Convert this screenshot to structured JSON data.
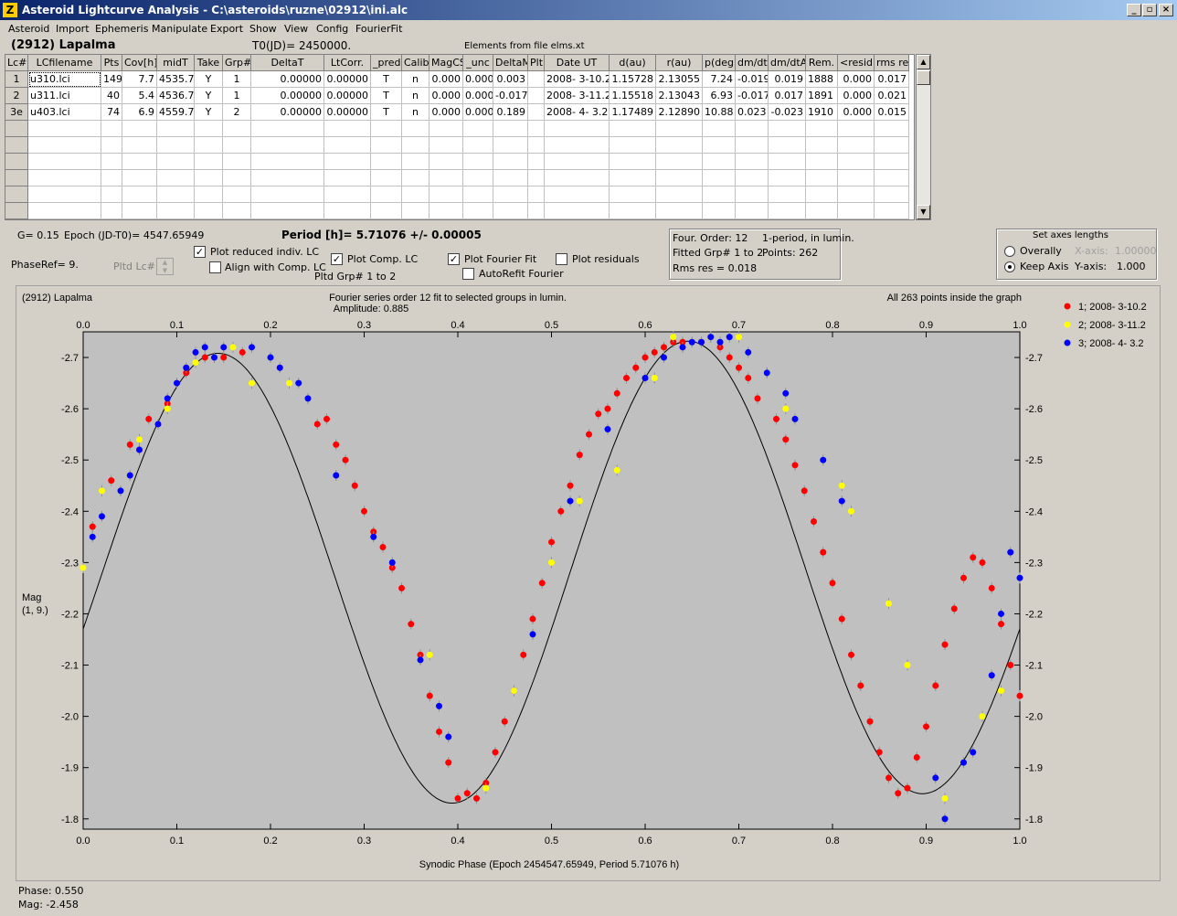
{
  "window": {
    "title": "Asteroid Lightcurve Analysis - C:\\asteroids\\ruzne\\02912\\ini.alc",
    "min": "_",
    "max": "▫",
    "close": "×"
  },
  "menu": [
    "Asteroid",
    "Import",
    "Ephemeris",
    "Manipulate",
    "Export",
    "Show",
    "View",
    "Config",
    "FourierFit"
  ],
  "header": {
    "asteroid": "(2912) Lapalma",
    "t0": "T0(JD)= 2450000.",
    "elements": "Elements from file elms.xt"
  },
  "table": {
    "columns": [
      "Lc#",
      "LCfilename",
      "Pts",
      "Cov[h]",
      "midT",
      "Take",
      "Grp#",
      "DeltaT",
      "LtCorr.",
      "_pred.",
      "Calib.",
      "MagCS",
      "_unc",
      "DeltaM",
      "Plt",
      "Date UT",
      "d(au)",
      "r(au)",
      "p(deg)",
      "dm/dt",
      "dm/dtA",
      "Rem.",
      "<resid>",
      "rms res"
    ],
    "rows": [
      [
        "1",
        "u310.lci",
        "149",
        "7.7",
        "4535.7",
        "Y",
        "1",
        "0.00000",
        "0.00000",
        "T",
        "n",
        "0.000",
        "0.000",
        "0.003",
        "",
        "2008- 3-10.2",
        "1.15728",
        "2.13055",
        "7.24",
        "-0.019",
        "0.019",
        "1888",
        "0.000",
        "0.017"
      ],
      [
        "2",
        "u311.lci",
        "40",
        "5.4",
        "4536.7",
        "Y",
        "1",
        "0.00000",
        "0.00000",
        "T",
        "n",
        "0.000",
        "0.000",
        "-0.017",
        "",
        "2008- 3-11.2",
        "1.15518",
        "2.13043",
        "6.93",
        "-0.017",
        "0.017",
        "1891",
        "0.000",
        "0.021"
      ],
      [
        "3e",
        "u403.lci",
        "74",
        "6.9",
        "4559.7",
        "Y",
        "2",
        "0.00000",
        "0.00000",
        "T",
        "n",
        "0.000",
        "0.000",
        "0.189",
        "",
        "2008- 4- 3.2",
        "1.17489",
        "2.12890",
        "10.88",
        "0.023",
        "-0.023",
        "1910",
        "0.000",
        "0.015"
      ]
    ]
  },
  "controls": {
    "g": "G= 0.15",
    "epoch": "Epoch (JD-T0)= 4547.65949",
    "period": "Period [h]= 5.71076 +/- 0.00005",
    "phaseref": "PhaseRef= 9.",
    "pltd_lc": "Pltd Lc#:",
    "plot_reduced": "Plot reduced indiv. LC",
    "align_comp": "Align with Comp. LC",
    "plot_comp": "Plot Comp. LC",
    "pltd_grp": "Pltd Grp#  1   to   2",
    "plot_fourier": "Plot Fourier Fit",
    "autorefit": "AutoRefit Fourier",
    "plot_resid": "Plot residuals",
    "four_order": "Four. Order: 12",
    "one_period": "1-period, in lumin.",
    "fitted_grp": "Fitted Grp# 1 to 2",
    "points": "Points: 262",
    "rms": "Rms res      = 0.018",
    "axes_title": "Set axes lengths",
    "overally": "Overally",
    "keep_axis": "Keep Axis",
    "xaxis_label": "X-axis:",
    "xaxis_val": "1.00000",
    "yaxis_label": "Y-axis:",
    "yaxis_val": "1.000"
  },
  "status": {
    "phase": "Phase:  0.550",
    "mag": "Mag:    -2.458"
  },
  "chart_data": {
    "type": "scatter",
    "title": "Fourier series order 12 fit to selected groups in lumin.",
    "subtitle": "Amplitude: 0.885",
    "top_left": "(2912) Lapalma",
    "top_right": "All 263 points inside the graph",
    "xlabel": "Synodic Phase (Epoch 2454547.65949, Period 5.71076 h)",
    "ylabel": "Mag",
    "ylabel2": "(1, 9.)",
    "xlim": [
      0,
      1
    ],
    "ylim": [
      -2.75,
      -1.78
    ],
    "y_inverted": true,
    "xticks": [
      0.0,
      0.1,
      0.2,
      0.3,
      0.4,
      0.5,
      0.6,
      0.7,
      0.8,
      0.9,
      1.0
    ],
    "yticks": [
      -2.7,
      -2.6,
      -2.5,
      -2.4,
      -2.3,
      -2.2,
      -2.1,
      -2.0,
      -1.9,
      -1.8
    ],
    "legend_position": "right",
    "series": [
      {
        "name": "1; 2008- 3-10.2",
        "color": "#ff0000",
        "x": [
          0.01,
          0.03,
          0.05,
          0.07,
          0.09,
          0.11,
          0.13,
          0.15,
          0.17,
          0.25,
          0.26,
          0.27,
          0.28,
          0.29,
          0.3,
          0.31,
          0.32,
          0.33,
          0.34,
          0.35,
          0.36,
          0.37,
          0.38,
          0.39,
          0.4,
          0.41,
          0.42,
          0.43,
          0.44,
          0.45,
          0.46,
          0.47,
          0.48,
          0.49,
          0.5,
          0.51,
          0.52,
          0.53,
          0.54,
          0.55,
          0.56,
          0.57,
          0.58,
          0.59,
          0.6,
          0.61,
          0.62,
          0.63,
          0.64,
          0.66,
          0.68,
          0.69,
          0.7,
          0.71,
          0.72,
          0.74,
          0.75,
          0.76,
          0.77,
          0.78,
          0.79,
          0.8,
          0.81,
          0.82,
          0.83,
          0.84,
          0.85,
          0.86,
          0.87,
          0.88,
          0.89,
          0.9,
          0.91,
          0.92,
          0.93,
          0.94,
          0.95,
          0.96,
          0.97,
          0.98,
          0.99,
          1.0
        ],
        "y": [
          -2.37,
          -2.46,
          -2.53,
          -2.58,
          -2.61,
          -2.67,
          -2.7,
          -2.7,
          -2.71,
          -2.57,
          -2.58,
          -2.53,
          -2.5,
          -2.45,
          -2.4,
          -2.36,
          -2.33,
          -2.29,
          -2.25,
          -2.18,
          -2.12,
          -2.04,
          -1.97,
          -1.91,
          -1.84,
          -1.85,
          -1.84,
          -1.87,
          -1.93,
          -1.99,
          -2.05,
          -2.12,
          -2.19,
          -2.26,
          -2.34,
          -2.4,
          -2.45,
          -2.51,
          -2.55,
          -2.59,
          -2.6,
          -2.63,
          -2.66,
          -2.68,
          -2.7,
          -2.71,
          -2.72,
          -2.73,
          -2.73,
          -2.73,
          -2.72,
          -2.7,
          -2.68,
          -2.66,
          -2.62,
          -2.58,
          -2.54,
          -2.49,
          -2.44,
          -2.38,
          -2.32,
          -2.26,
          -2.19,
          -2.12,
          -2.06,
          -1.99,
          -1.93,
          -1.88,
          -1.85,
          -1.86,
          -1.92,
          -1.98,
          -2.06,
          -2.14,
          -2.21,
          -2.27,
          -2.31,
          -2.3,
          -2.25,
          -2.18,
          -2.1,
          -2.04
        ]
      },
      {
        "name": "2; 2008- 3-11.2",
        "color": "#ffff00",
        "x": [
          0.0,
          0.02,
          0.06,
          0.09,
          0.12,
          0.16,
          0.18,
          0.22,
          0.37,
          0.43,
          0.46,
          0.48,
          0.5,
          0.53,
          0.57,
          0.61,
          0.63,
          0.67,
          0.7,
          0.73,
          0.75,
          0.81,
          0.82,
          0.86,
          0.88,
          0.92,
          0.96,
          0.98
        ],
        "y": [
          -2.29,
          -2.44,
          -2.54,
          -2.6,
          -2.69,
          -2.72,
          -2.65,
          -2.65,
          -2.12,
          -1.86,
          -2.05,
          -2.16,
          -2.3,
          -2.42,
          -2.48,
          -2.66,
          -2.74,
          -2.74,
          -2.74,
          -2.67,
          -2.6,
          -2.45,
          -2.4,
          -2.22,
          -2.1,
          -1.84,
          -2.0,
          -2.05
        ]
      },
      {
        "name": "3; 2008- 4- 3.2",
        "color": "#0000ff",
        "x": [
          0.01,
          0.02,
          0.04,
          0.05,
          0.06,
          0.08,
          0.09,
          0.1,
          0.11,
          0.12,
          0.13,
          0.14,
          0.15,
          0.18,
          0.2,
          0.21,
          0.23,
          0.24,
          0.27,
          0.31,
          0.33,
          0.36,
          0.38,
          0.39,
          0.48,
          0.52,
          0.56,
          0.6,
          0.62,
          0.64,
          0.65,
          0.66,
          0.67,
          0.68,
          0.69,
          0.71,
          0.73,
          0.75,
          0.76,
          0.79,
          0.81,
          0.91,
          0.92,
          0.94,
          0.95,
          0.97,
          0.98,
          0.99,
          1.0
        ],
        "y": [
          -2.35,
          -2.39,
          -2.44,
          -2.47,
          -2.52,
          -2.57,
          -2.62,
          -2.65,
          -2.68,
          -2.71,
          -2.72,
          -2.7,
          -2.72,
          -2.72,
          -2.7,
          -2.68,
          -2.65,
          -2.62,
          -2.47,
          -2.35,
          -2.3,
          -2.11,
          -2.02,
          -1.96,
          -2.16,
          -2.42,
          -2.56,
          -2.66,
          -2.7,
          -2.72,
          -2.73,
          -2.73,
          -2.74,
          -2.73,
          -2.74,
          -2.71,
          -2.67,
          -2.63,
          -2.58,
          -2.5,
          -2.42,
          -1.88,
          -1.8,
          -1.91,
          -1.93,
          -2.08,
          -2.2,
          -2.32,
          -2.27
        ]
      }
    ]
  }
}
